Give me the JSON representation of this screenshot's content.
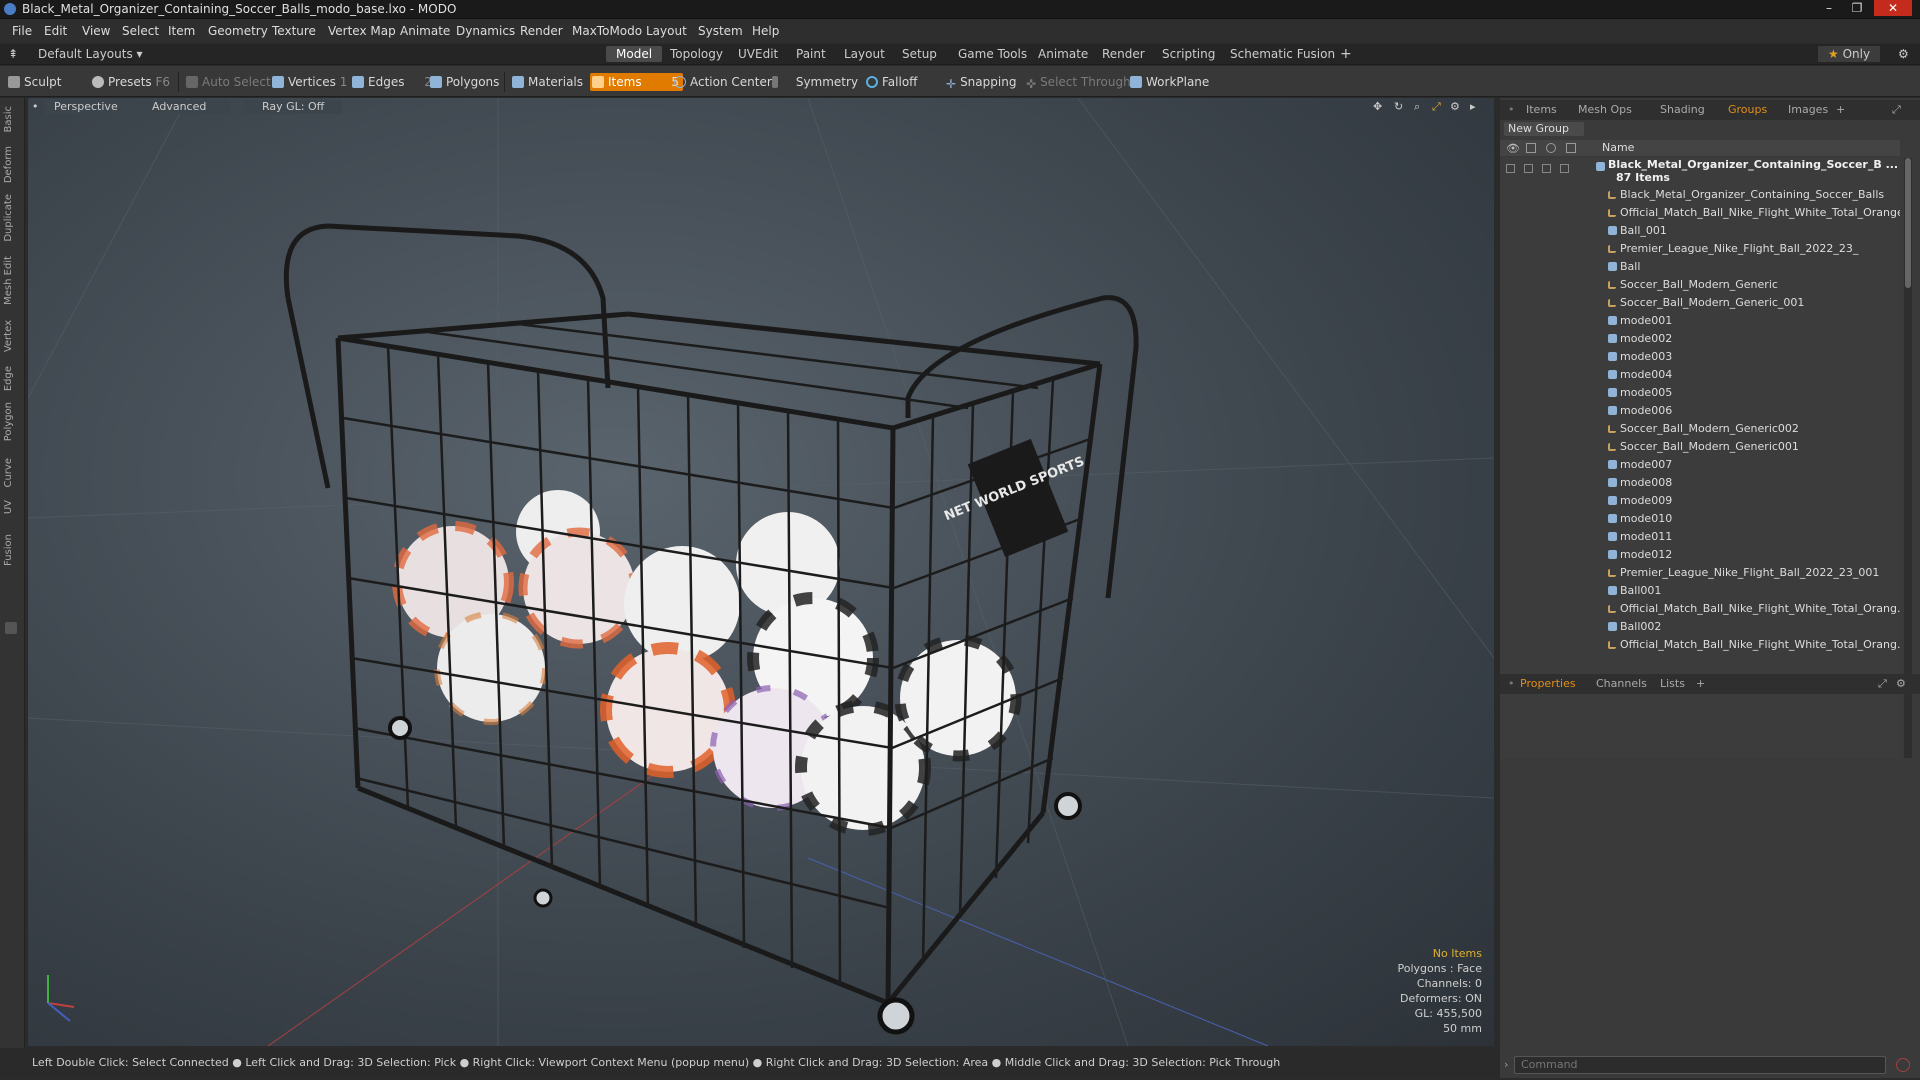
{
  "window": {
    "title": "Black_Metal_Organizer_Containing_Soccer_Balls_modo_base.lxo - MODO",
    "controls": [
      "–",
      "❐",
      "✕"
    ]
  },
  "menu": [
    "File",
    "Edit",
    "View",
    "Select",
    "Item",
    "Geometry",
    "Texture",
    "Vertex Map",
    "Animate",
    "Dynamics",
    "Render",
    "MaxToModo",
    "Layout",
    "System",
    "Help"
  ],
  "layout_bar": {
    "layouts_label": "Default Layouts",
    "tabs": [
      "Model",
      "Topology",
      "UVEdit",
      "Paint",
      "Layout",
      "Setup",
      "Game Tools",
      "Animate",
      "Render",
      "Scripting",
      "Schematic Fusion"
    ],
    "active_tab": "Model",
    "plus": "+",
    "only_label": "Only"
  },
  "toolbar": {
    "sculpt": "Sculpt",
    "presets": "Presets",
    "presets_key": "F6",
    "auto_select": "Auto Select",
    "vertices": "Vertices",
    "vertices_count": "1",
    "edges": "Edges",
    "edges_count": "2",
    "polygons": "Polygons",
    "materials": "Materials",
    "items": "Items",
    "items_count": "5",
    "action_center": "Action Center",
    "symmetry": "Symmetry",
    "falloff": "Falloff",
    "snapping": "Snapping",
    "select_through": "Select Through",
    "workplane": "WorkPlane"
  },
  "left_tabs": [
    "Basic",
    "Deform",
    "Duplicate",
    "Mesh Edit",
    "Vertex",
    "Edge",
    "Polygon",
    "Curve",
    "UV",
    "Fusion"
  ],
  "viewport": {
    "view_mode": "Perspective",
    "shading": "Advanced",
    "raygl": "Ray GL: Off",
    "sign_text": "NET WORLD SPORTS",
    "stats": {
      "no_items": "No Items",
      "polygons": "Polygons : Face",
      "channels": "Channels: 0",
      "deformers": "Deformers: ON",
      "gl": "GL: 455,500",
      "scale": "50 mm"
    }
  },
  "status_bar": "Left Double Click: Select Connected ● Left Click and Drag: 3D Selection: Pick ● Right Click: Viewport Context Menu (popup menu) ● Right Click and Drag: 3D Selection: Area ● Middle Click and Drag: 3D Selection: Pick Through",
  "groups_panel": {
    "tabs": [
      "Items",
      "Mesh Ops",
      "Shading",
      "Groups",
      "Images",
      "+"
    ],
    "active_tab": "Groups",
    "new_group": "New Group",
    "column_name": "Name",
    "root": {
      "label": "Black_Metal_Organizer_Containing_Soccer_B ...",
      "sub": "87 Items"
    },
    "items": [
      {
        "label": "Black_Metal_Organizer_Containing_Soccer_Balls",
        "type": "loc"
      },
      {
        "label": "Official_Match_Ball_Nike_Flight_White_Total_Orange",
        "type": "loc"
      },
      {
        "label": "Ball_001",
        "type": "mesh"
      },
      {
        "label": "Premier_League_Nike_Flight_Ball_2022_23_",
        "type": "loc"
      },
      {
        "label": "Ball",
        "type": "mesh"
      },
      {
        "label": "Soccer_Ball_Modern_Generic",
        "type": "loc"
      },
      {
        "label": "Soccer_Ball_Modern_Generic_001",
        "type": "loc"
      },
      {
        "label": "mode001",
        "type": "mesh"
      },
      {
        "label": "mode002",
        "type": "mesh"
      },
      {
        "label": "mode003",
        "type": "mesh"
      },
      {
        "label": "mode004",
        "type": "mesh"
      },
      {
        "label": "mode005",
        "type": "mesh"
      },
      {
        "label": "mode006",
        "type": "mesh"
      },
      {
        "label": "Soccer_Ball_Modern_Generic002",
        "type": "loc"
      },
      {
        "label": "Soccer_Ball_Modern_Generic001",
        "type": "loc"
      },
      {
        "label": "mode007",
        "type": "mesh"
      },
      {
        "label": "mode008",
        "type": "mesh"
      },
      {
        "label": "mode009",
        "type": "mesh"
      },
      {
        "label": "mode010",
        "type": "mesh"
      },
      {
        "label": "mode011",
        "type": "mesh"
      },
      {
        "label": "mode012",
        "type": "mesh"
      },
      {
        "label": "Premier_League_Nike_Flight_Ball_2022_23_001",
        "type": "loc"
      },
      {
        "label": "Ball001",
        "type": "mesh"
      },
      {
        "label": "Official_Match_Ball_Nike_Flight_White_Total_Orang...",
        "type": "loc"
      },
      {
        "label": "Ball002",
        "type": "mesh"
      },
      {
        "label": "Official_Match_Ball_Nike_Flight_White_Total_Orang...",
        "type": "loc"
      }
    ]
  },
  "properties_panel": {
    "tabs": [
      "Properties",
      "Channels",
      "Lists",
      "+"
    ],
    "active_tab": "Properties"
  },
  "command": {
    "placeholder": "Command"
  },
  "colors": {
    "accent": "#e07b00",
    "panel": "#3a3a3a"
  }
}
